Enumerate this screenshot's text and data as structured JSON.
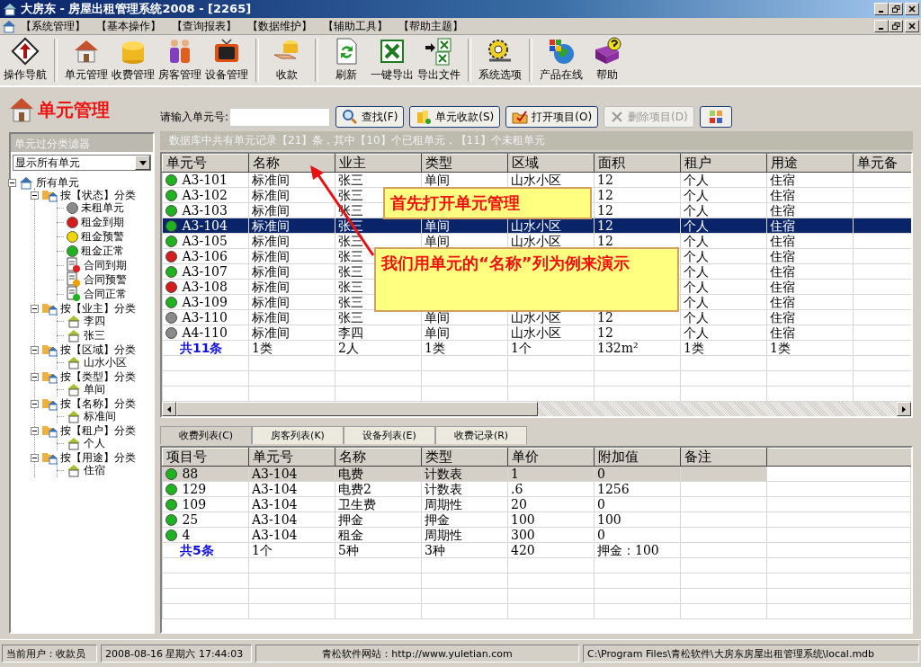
{
  "window": {
    "title": "大房东 - 房屋出租管理系统2008 - [2265]"
  },
  "menu": [
    "【系统管理】",
    "【基本操作】",
    "【查询报表】",
    "【数据维护】",
    "【辅助工具】",
    "【帮助主题】"
  ],
  "toolbar": [
    {
      "items": [
        {
          "label": "操作导航",
          "kind": "nav"
        }
      ]
    },
    {
      "items": [
        {
          "label": "单元管理",
          "kind": "house"
        },
        {
          "label": "收费管理",
          "kind": "coins"
        },
        {
          "label": "房客管理",
          "kind": "people"
        },
        {
          "label": "设备管理",
          "kind": "tv"
        }
      ]
    },
    {
      "items": [
        {
          "label": "收款",
          "kind": "pay"
        }
      ]
    },
    {
      "items": [
        {
          "label": "刷新",
          "kind": "refresh"
        },
        {
          "label": "一键导出",
          "kind": "excel"
        },
        {
          "label": "导出文件",
          "kind": "export"
        }
      ]
    },
    {
      "items": [
        {
          "label": "系统选项",
          "kind": "settings"
        }
      ]
    },
    {
      "items": [
        {
          "label": "产品在线",
          "kind": "globe"
        },
        {
          "label": "帮助",
          "kind": "help"
        }
      ]
    }
  ],
  "page_title": "单元管理",
  "filter": {
    "title": "单元过分类滤器",
    "select": "显示所有单元",
    "tree": [
      {
        "label": "所有单元",
        "kind": "root",
        "expanded": true,
        "children": [
          {
            "label": "按【状态】分类",
            "kind": "group",
            "expanded": true,
            "children": [
              {
                "label": "未租单元",
                "kind": "dot",
                "color": "#8a8a8a"
              },
              {
                "label": "租金到期",
                "kind": "dot",
                "color": "#d41c1c"
              },
              {
                "label": "租金预警",
                "kind": "dot",
                "color": "#f2d600"
              },
              {
                "label": "租金正常",
                "kind": "dot",
                "color": "#1fb31f"
              },
              {
                "label": "合同到期",
                "kind": "doc",
                "color": "#e02020"
              },
              {
                "label": "合同预警",
                "kind": "doc",
                "color": "#f0a000"
              },
              {
                "label": "合同正常",
                "kind": "doc",
                "color": "#1fb31f"
              }
            ]
          },
          {
            "label": "按【业主】分类",
            "kind": "group",
            "expanded": true,
            "children": [
              {
                "label": "李四",
                "kind": "house"
              },
              {
                "label": "张三",
                "kind": "house"
              }
            ]
          },
          {
            "label": "按【区域】分类",
            "kind": "group",
            "expanded": true,
            "children": [
              {
                "label": "山水小区",
                "kind": "house"
              }
            ]
          },
          {
            "label": "按【类型】分类",
            "kind": "group",
            "expanded": true,
            "children": [
              {
                "label": "单间",
                "kind": "house"
              }
            ]
          },
          {
            "label": "按【名称】分类",
            "kind": "group",
            "expanded": true,
            "children": [
              {
                "label": "标准间",
                "kind": "house"
              }
            ]
          },
          {
            "label": "按【租户】分类",
            "kind": "group",
            "expanded": true,
            "children": [
              {
                "label": "个人",
                "kind": "house"
              }
            ]
          },
          {
            "label": "按【用途】分类",
            "kind": "group",
            "expanded": true,
            "children": [
              {
                "label": "住宿",
                "kind": "house"
              }
            ]
          }
        ]
      }
    ]
  },
  "search": {
    "label": "请输入单元号:"
  },
  "buttons": [
    {
      "label": "查找(F)",
      "kind": "search",
      "disabled": false
    },
    {
      "label": "单元收款(S)",
      "kind": "collect",
      "disabled": false
    },
    {
      "label": "打开项目(O)",
      "kind": "open",
      "disabled": false
    },
    {
      "label": "删除项目(D)",
      "kind": "delete",
      "disabled": true
    },
    {
      "kind": "palette",
      "disabled": false
    }
  ],
  "info": "数据库中共有单元记录【21】条，其中【10】个已租单元，【11】个未租单元",
  "units": {
    "columns": [
      "单元号",
      "名称",
      "业主",
      "类型",
      "区域",
      "面积",
      "租户",
      "用途",
      "单元备"
    ],
    "rows": [
      {
        "cells": [
          "A3-101",
          "标准间",
          "张三",
          "单间",
          "山水小区",
          "12",
          "个人",
          "住宿"
        ],
        "color": "#1fb31f",
        "selected": false
      },
      {
        "cells": [
          "A3-102",
          "标准间",
          "张三",
          null,
          null,
          "12",
          "个人",
          "住宿"
        ],
        "color": "#1fb31f",
        "selected": false
      },
      {
        "cells": [
          "A3-103",
          "标准间",
          "张三",
          null,
          null,
          "12",
          "个人",
          "住宿"
        ],
        "color": "#1fb31f",
        "selected": false
      },
      {
        "cells": [
          "A3-104",
          "标准间",
          "张三",
          "单间",
          "山水小区",
          "12",
          "个人",
          "住宿"
        ],
        "color": "#1fb31f",
        "selected": true
      },
      {
        "cells": [
          "A3-105",
          "标准间",
          "张三",
          "单间",
          "山水小区",
          "12",
          "个人",
          "住宿"
        ],
        "color": "#1fb31f",
        "selected": false
      },
      {
        "cells": [
          "A3-106",
          "标准间",
          "张三",
          null,
          null,
          null,
          "个人",
          "住宿"
        ],
        "color": "#d41c1c",
        "selected": false
      },
      {
        "cells": [
          "A3-107",
          "标准间",
          "张三",
          null,
          null,
          null,
          "个人",
          "住宿"
        ],
        "color": "#1fb31f",
        "selected": false
      },
      {
        "cells": [
          "A3-108",
          "标准间",
          "张三",
          null,
          null,
          null,
          "个人",
          "住宿"
        ],
        "color": "#d41c1c",
        "selected": false
      },
      {
        "cells": [
          "A3-109",
          "标准间",
          "张三",
          null,
          null,
          null,
          "个人",
          "住宿"
        ],
        "color": "#1fb31f",
        "selected": false
      },
      {
        "cells": [
          "A3-110",
          "标准间",
          "张三",
          "单间",
          "山水小区",
          "12",
          "个人",
          "住宿"
        ],
        "color": "#8a8a8a",
        "selected": false
      },
      {
        "cells": [
          "A4-110",
          "标准间",
          "李四",
          "单间",
          "山水小区",
          "12",
          "个人",
          "住宿"
        ],
        "color": "#8a8a8a",
        "selected": false
      }
    ],
    "total": [
      "共11条",
      "1类",
      "2人",
      "1类",
      "1个",
      "132m²",
      "1类",
      "1类"
    ]
  },
  "tabs": [
    {
      "label": "收费列表(C)",
      "selected": true
    },
    {
      "label": "房客列表(K)",
      "selected": false
    },
    {
      "label": "设备列表(E)",
      "selected": false
    },
    {
      "label": "收费记录(R)",
      "selected": false
    }
  ],
  "charges": {
    "columns": [
      "项目号",
      "单元号",
      "名称",
      "类型",
      "单价",
      "附加值",
      "备注"
    ],
    "rows": [
      {
        "cells": [
          "88",
          "A3-104",
          "电费",
          "计数表",
          "1",
          "0"
        ],
        "color": "#1fb31f",
        "selected": true
      },
      {
        "cells": [
          "129",
          "A3-104",
          "电费2",
          "计数表",
          ".6",
          "1256"
        ],
        "color": "#1fb31f",
        "selected": false
      },
      {
        "cells": [
          "109",
          "A3-104",
          "卫生费",
          "周期性",
          "20",
          "0"
        ],
        "color": "#1fb31f",
        "selected": false
      },
      {
        "cells": [
          "25",
          "A3-104",
          "押金",
          "押金",
          "100",
          "100"
        ],
        "color": "#1fb31f",
        "selected": false
      },
      {
        "cells": [
          "4",
          "A3-104",
          "租金",
          "周期性",
          "300",
          "0"
        ],
        "color": "#1fb31f",
        "selected": false
      }
    ],
    "total": [
      "共5条",
      "1个",
      "5种",
      "3种",
      "420",
      "押金：100"
    ]
  },
  "callouts": [
    {
      "text": "首先打开单元管理"
    },
    {
      "text": "我们用单元的“名称”列为例来演示"
    }
  ],
  "status_bar": [
    "当前用户：收款员",
    "2008-08-16 星期六 17:44:03",
    "青松软件网站：http://www.yuletian.com",
    "C:\\Program Files\\青松软件\\大房东房屋出租管理系统\\local.mdb"
  ]
}
